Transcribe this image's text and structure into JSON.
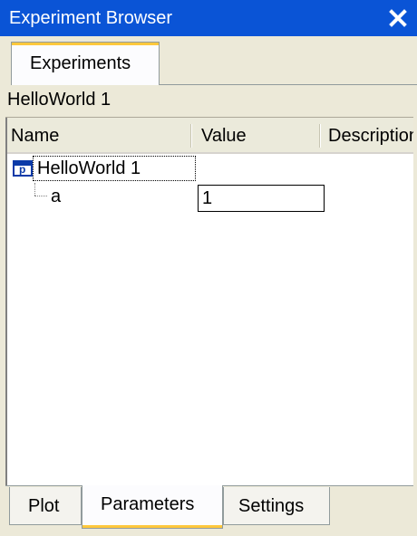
{
  "window": {
    "title": "Experiment Browser"
  },
  "tabs": [
    {
      "label": "Experiments"
    }
  ],
  "experiment_name": "HelloWorld 1",
  "columns": [
    "Name",
    "Value",
    "Description"
  ],
  "tree": {
    "root_label": "HelloWorld 1",
    "root_icon": "parameter-icon",
    "params": [
      {
        "name": "a",
        "value": "1"
      }
    ]
  },
  "bottom_tabs": [
    {
      "label": "Plot"
    },
    {
      "label": "Parameters"
    },
    {
      "label": "Settings"
    }
  ],
  "active_bottom_tab": "Parameters",
  "colors": {
    "titlebar": "#0a54d6",
    "tab_accent": "#ffc83c",
    "panel_bg": "#ece9d8"
  }
}
